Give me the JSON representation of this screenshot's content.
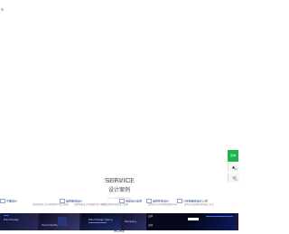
{
  "header": {
    "logo_alt": ""
  },
  "section": {
    "title_en": "SERVICE",
    "title_zh": "设计案例",
    "subtitle": "Successful Cases"
  },
  "tabs": [
    {
      "label": "平面设计"
    },
    {
      "label": "品牌策划设计"
    },
    {
      "label": "包装设计案例"
    },
    {
      "label": "品牌形象设计"
    },
    {
      "label": "VI系统策划设计公司"
    }
  ],
  "captions": [
    "深圳品牌设计公司提供的VI设计服务",
    "品牌形象设计的发展历程与规划",
    "专业品牌视觉形象设计策划",
    "品牌设计公司提供的服务内容",
    "提升企业品牌价值的设计方法"
  ],
  "tiles": [
    {
      "text": "Brand Design"
    },
    {
      "text": "Visual Identity"
    },
    {
      "text": "Brand Design Agency"
    },
    {
      "text": "Packaging"
    },
    {
      "text": "品牌"
    },
    {
      "text": "品牌"
    }
  ],
  "more_button": "MORE",
  "side_panel": {
    "top_label": "咨询",
    "items": [
      {
        "icon": "▲",
        "label": "顶部"
      },
      {
        "icon": "☏",
        "label": "电话"
      }
    ]
  }
}
